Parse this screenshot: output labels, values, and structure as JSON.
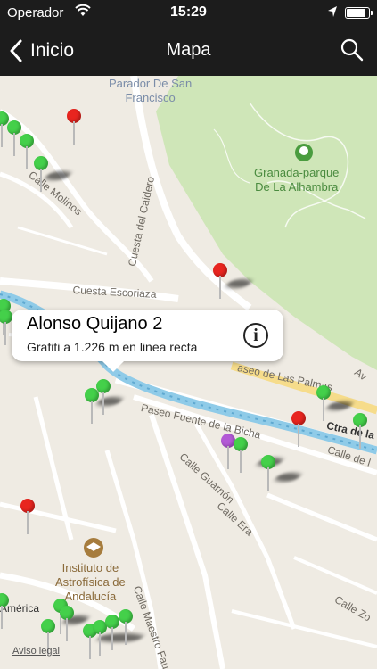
{
  "status_bar": {
    "carrier": "Operador",
    "time": "15:29",
    "battery_level": 0.9
  },
  "nav": {
    "back_label": "Inicio",
    "title": "Mapa"
  },
  "map": {
    "labels": {
      "parador": "Parador De San\nFrancisco",
      "park": "Granada-parque\nDe La Alhambra",
      "calle_molinos": "Calle Molinos",
      "cuesta_caidero": "Cuesta del Caidero",
      "cuesta_escoriaza": "Cuesta Escoriaza",
      "paseo_palmas": "aseo de Las Palmas",
      "paseo_bicha": "Paseo Fuente de la Bicha",
      "calle_guarnon": "Calle Guarnón",
      "calle_era": "Calle Era",
      "ctra": "Ctra de la",
      "calle_de": "Calle de l",
      "av": "Av",
      "instituto": "Instituto de\nAstrofísica de\nAndalucía",
      "calle_maestro": "Calle Maestro Faus",
      "calle_zo": "Calle Zo",
      "america": "América"
    },
    "legal": "Aviso legal"
  },
  "callout": {
    "title": "Alonso Quijano 2",
    "subtitle": "Grafiti a 1.226 m en linea recta",
    "info_icon": "i"
  },
  "colors": {
    "pin_red": "#e8251f",
    "pin_green": "#44d04a",
    "pin_purple": "#b35ad6",
    "park": "#cfe6b8",
    "river": "#8fcbe8"
  }
}
